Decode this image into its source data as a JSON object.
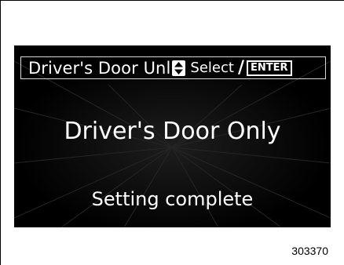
{
  "display": {
    "header_title": "Driver's Door Unl",
    "select_label": "Select",
    "slash": "/",
    "enter_label": "ENTER",
    "value": "Driver's Door Only",
    "status": "Setting complete"
  },
  "figure_number": "303370",
  "colors": {
    "screen_bg": "#000000",
    "text": "#ffffff",
    "page_bg": "#ffffff"
  }
}
